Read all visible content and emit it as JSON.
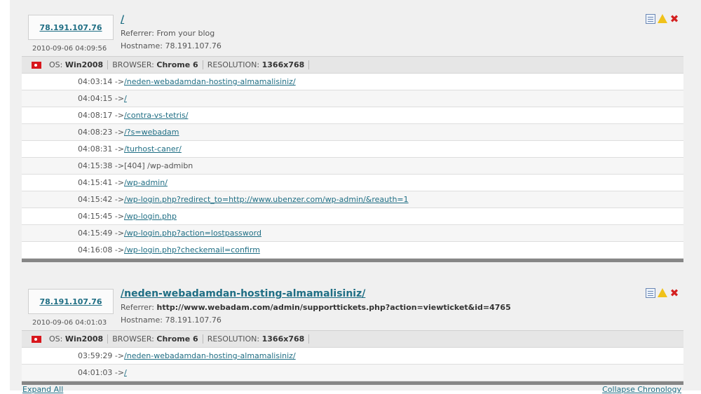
{
  "visits": [
    {
      "ip": "78.191.107.76",
      "timestamp": "2010-09-06 04:09:56",
      "path": "/",
      "referrer_label": "Referrer:",
      "referrer": "From your blog",
      "referrer_bold": false,
      "hostname_label": "Hostname:",
      "hostname": "78.191.107.76",
      "os_label": "OS:",
      "os": "Win2008",
      "browser_label": "BROWSER:",
      "browser": "Chrome 6",
      "resolution_label": "RESOLUTION:",
      "resolution": "1366x768",
      "pageviews": [
        {
          "time": "04:03:14",
          "arrow": "->",
          "url": "/neden-webadamdan-hosting-almamalisiniz/",
          "link": true
        },
        {
          "time": "04:04:15",
          "arrow": "->",
          "url": "/",
          "link": true
        },
        {
          "time": "04:08:17",
          "arrow": "->",
          "url": "/contra-vs-tetris/",
          "link": true
        },
        {
          "time": "04:08:23",
          "arrow": "->",
          "url": "/?s=webadam",
          "link": true
        },
        {
          "time": "04:08:31",
          "arrow": "->",
          "url": "/turhost-caner/",
          "link": true
        },
        {
          "time": "04:15:38",
          "arrow": "->",
          "url": "[404] /wp-admibn",
          "link": false
        },
        {
          "time": "04:15:41",
          "arrow": "->",
          "url": "/wp-admin/",
          "link": true
        },
        {
          "time": "04:15:42",
          "arrow": "->",
          "url": "/wp-login.php?redirect_to=http://www.ubenzer.com/wp-admin/&reauth=1",
          "link": true
        },
        {
          "time": "04:15:45",
          "arrow": "->",
          "url": "/wp-login.php",
          "link": true
        },
        {
          "time": "04:15:49",
          "arrow": "->",
          "url": "/wp-login.php?action=lostpassword",
          "link": true
        },
        {
          "time": "04:16:08",
          "arrow": "->",
          "url": "/wp-login.php?checkemail=confirm",
          "link": true
        }
      ]
    },
    {
      "ip": "78.191.107.76",
      "timestamp": "2010-09-06 04:01:03",
      "path": "/neden-webadamdan-hosting-almamalisiniz/",
      "referrer_label": "Referrer:",
      "referrer": "http://www.webadam.com/admin/supporttickets.php?action=viewticket&id=4765",
      "referrer_bold": true,
      "hostname_label": "Hostname:",
      "hostname": "78.191.107.76",
      "os_label": "OS:",
      "os": "Win2008",
      "browser_label": "BROWSER:",
      "browser": "Chrome 6",
      "resolution_label": "RESOLUTION:",
      "resolution": "1366x768",
      "pageviews": [
        {
          "time": "03:59:29",
          "arrow": "->",
          "url": "/neden-webadamdan-hosting-almamalisiniz/",
          "link": true
        },
        {
          "time": "04:01:03",
          "arrow": "->",
          "url": "/",
          "link": true
        }
      ]
    }
  ],
  "footer": {
    "expand_all": "Expand All",
    "collapse_chronology": "Collapse Chronology"
  },
  "icons": {
    "details": "page-icon",
    "warn": "warning-icon",
    "delete": "delete-icon"
  },
  "colors": {
    "link": "#1f6e84",
    "delete": "#d42020",
    "warn": "#f0c21b",
    "flag": "#d8161c"
  }
}
